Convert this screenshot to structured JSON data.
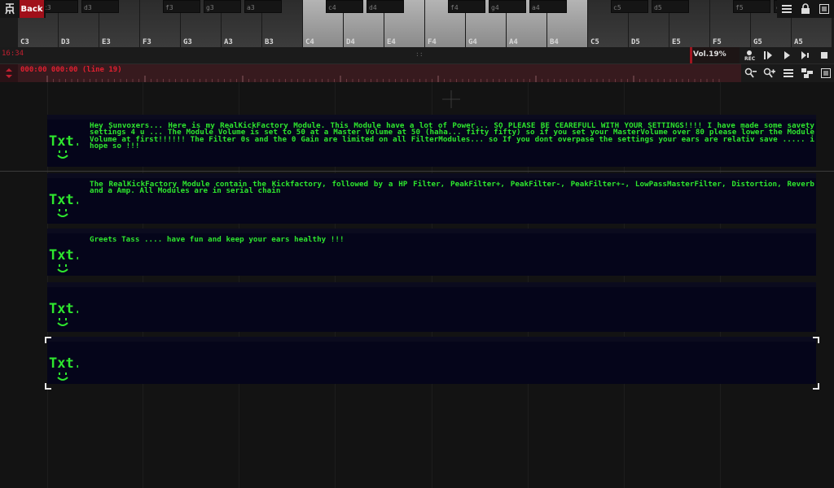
{
  "toolbar": {
    "back_label": "Back",
    "logo_icon": "sunvox-logo-icon",
    "menu_icon": "menu-icon",
    "lock_icon": "lock-icon",
    "fullscreen_icon": "fullscreen-icon"
  },
  "keyboard": {
    "white_keys": [
      "C3",
      "D3",
      "E3",
      "F3",
      "G3",
      "A3",
      "B3",
      "C4",
      "D4",
      "E4",
      "F4",
      "G4",
      "A4",
      "B4",
      "C5",
      "D5",
      "E5",
      "F5",
      "G5",
      "A5"
    ],
    "black_keys": [
      "c3",
      "d3",
      "f3",
      "g3",
      "a3",
      "c4",
      "d4",
      "f4",
      "g4",
      "a4",
      "c5",
      "d5",
      "f5",
      "g5"
    ],
    "highlight_color": "#aaaaaa"
  },
  "status": {
    "cpu_time": "16:34",
    "center_handle": "::",
    "volume_label": "Vol.19%",
    "rec_label": "REC",
    "accent_color": "#a0101a"
  },
  "transport": [
    "rec-button",
    "play-pattern-button",
    "play-button",
    "play-from-start-button",
    "stop-button"
  ],
  "timeline": {
    "time_text": "000:00  000:00 (line 19)",
    "tools": [
      "zoom-out-icon",
      "zoom-in-icon",
      "list-icon",
      "layout-icon",
      "fullscreen-icon"
    ]
  },
  "modules": [
    {
      "icon": "Txt.",
      "text": "Hey Sunvoxers... Here is my RealKickFactory Module. This Module have a lot of Power... SO PLEASE BE CEAREFULL WITH YOUR SETTINGS!!!! I have made some savety settings 4 u ... The Module Volume is set to 50 at a Master Volume at 50 (haha... fifty fifty)  so if you set your MasterVolume over 80 please lower the Module Volume  at first!!!!!!  The Filter 0s and the 0 Gain are limited on all FilterModules... so If you dont overpase the settings your ears are relativ save ..... i hope so !!!"
    },
    {
      "icon": "Txt.",
      "text": "The RealKickFactory Module contain the Kickfactory, followed by a HP Filter, PeakFilter+, PeakFilter-, PeakFilter+-, LowPassMasterFilter, Distortion, Reverb and a Amp. All Modules are in serial chain"
    },
    {
      "icon": "Txt.",
      "text": "Greets Tass .... have fun and keep your ears healthy !!!"
    },
    {
      "icon": "Txt.",
      "text": ""
    },
    {
      "icon": "Txt.",
      "text": ""
    }
  ],
  "colors": {
    "text_green": "#2ee62e",
    "module_bg": "#05051a"
  }
}
